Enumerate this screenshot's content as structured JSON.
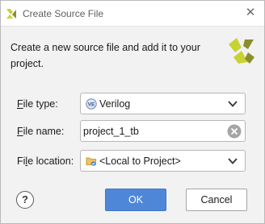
{
  "window": {
    "title": "Create Source File"
  },
  "description": "Create a new source file and add it to your project.",
  "fields": {
    "file_type": {
      "label_underlined": "F",
      "label_rest": "ile type:",
      "value": "Verilog",
      "icon": "verilog-file-icon"
    },
    "file_name": {
      "label_underlined": "F",
      "label_rest": "ile name:",
      "value": "project_1_tb"
    },
    "file_location": {
      "label_start": "Fi",
      "label_underlined": "l",
      "label_rest": "e location:",
      "value": "<Local to Project>",
      "icon": "folder-icon"
    }
  },
  "buttons": {
    "help": "?",
    "ok": "OK",
    "cancel": "Cancel"
  },
  "colors": {
    "accent": "#4f87d8",
    "logo_yellow": "#c9d234",
    "logo_olive": "#8a8f2c",
    "dialog_bg": "#f2f2f2"
  }
}
